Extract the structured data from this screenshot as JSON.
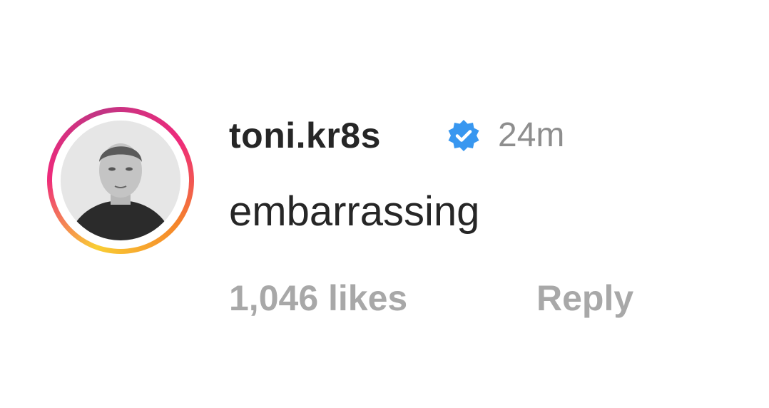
{
  "comment": {
    "username": "toni.kr8s",
    "verified_icon": "verified-badge-icon",
    "timestamp": "24m",
    "text": "embarrassing",
    "likes": "1,046 likes",
    "reply_label": "Reply"
  },
  "colors": {
    "username": "#262626",
    "secondary": "#8e8e8e",
    "action": "#a8a8a8",
    "verified": "#3897f0",
    "story_ring_start": "#f9ce34",
    "story_ring_mid": "#ee2a7b",
    "story_ring_end": "#c13584"
  }
}
